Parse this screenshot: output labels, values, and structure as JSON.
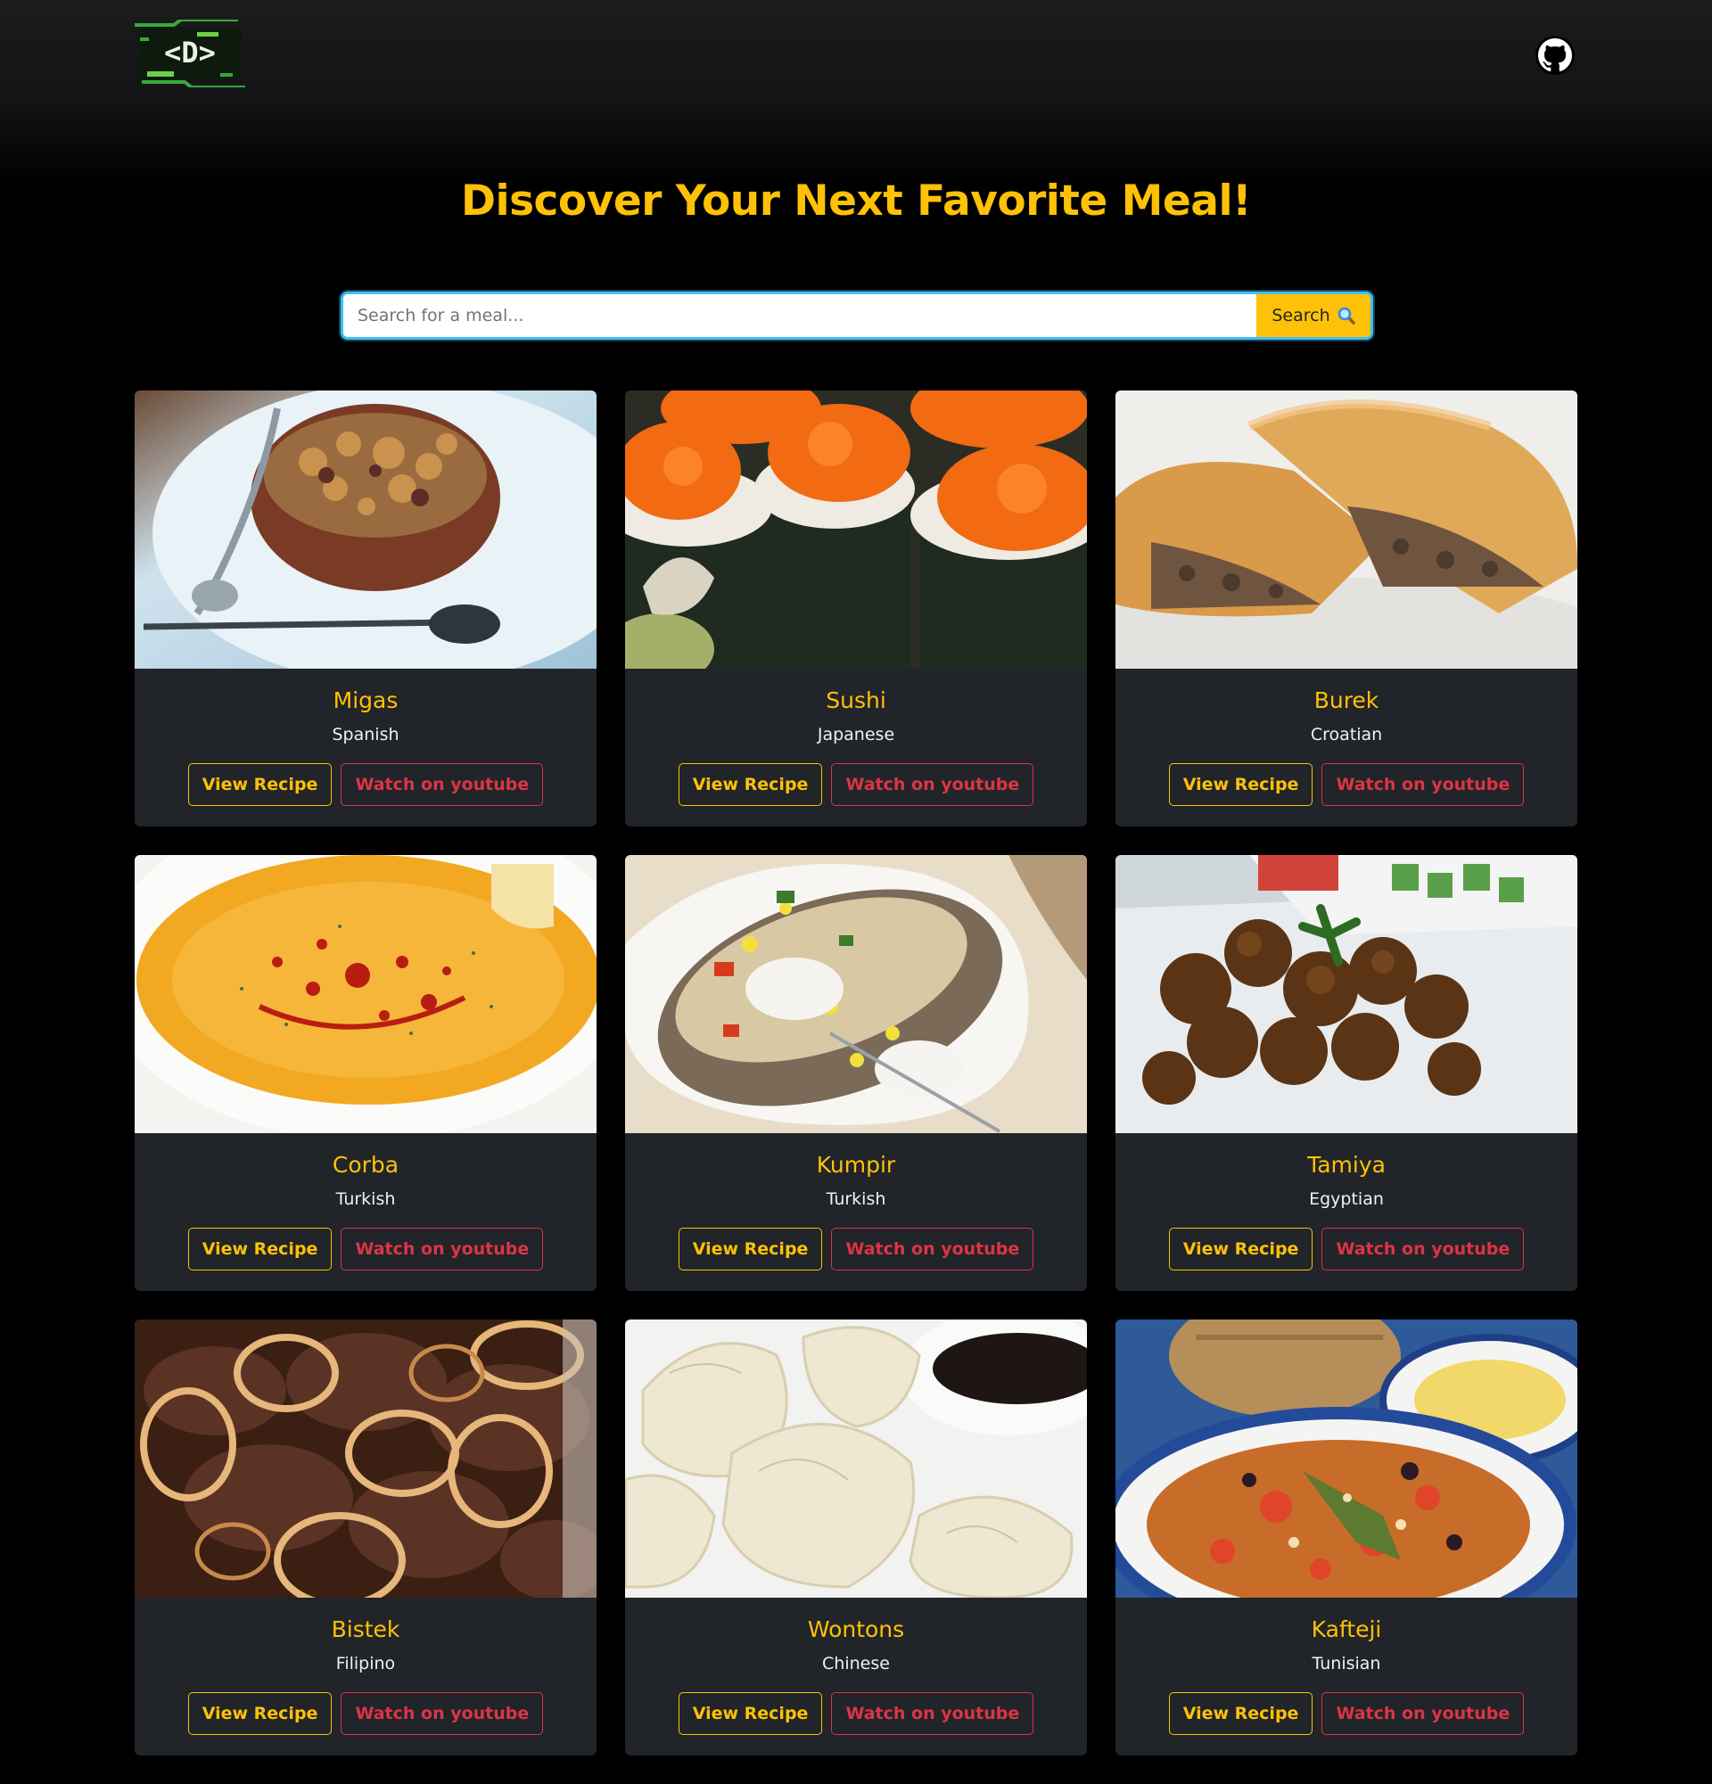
{
  "navbar": {
    "logo_text": "<D>",
    "github_icon": "github-icon"
  },
  "hero": {
    "title": "Discover Your Next Favorite Meal!"
  },
  "search": {
    "placeholder": "Search for a meal...",
    "value": "",
    "button_label": "Search",
    "button_icon": "magnifier-icon"
  },
  "meals": [
    {
      "name": "Migas",
      "area": "Spanish",
      "recipe_label": "View Recipe",
      "youtube_label": "Watch on youtube",
      "image_icon": "migas-image"
    },
    {
      "name": "Sushi",
      "area": "Japanese",
      "recipe_label": "View Recipe",
      "youtube_label": "Watch on youtube",
      "image_icon": "sushi-image"
    },
    {
      "name": "Burek",
      "area": "Croatian",
      "recipe_label": "View Recipe",
      "youtube_label": "Watch on youtube",
      "image_icon": "burek-image"
    },
    {
      "name": "Corba",
      "area": "Turkish",
      "recipe_label": "View Recipe",
      "youtube_label": "Watch on youtube",
      "image_icon": "corba-image"
    },
    {
      "name": "Kumpir",
      "area": "Turkish",
      "recipe_label": "View Recipe",
      "youtube_label": "Watch on youtube",
      "image_icon": "kumpir-image"
    },
    {
      "name": "Tamiya",
      "area": "Egyptian",
      "recipe_label": "View Recipe",
      "youtube_label": "Watch on youtube",
      "image_icon": "tamiya-image"
    },
    {
      "name": "Bistek",
      "area": "Filipino",
      "recipe_label": "View Recipe",
      "youtube_label": "Watch on youtube",
      "image_icon": "bistek-image"
    },
    {
      "name": "Wontons",
      "area": "Chinese",
      "recipe_label": "View Recipe",
      "youtube_label": "Watch on youtube",
      "image_icon": "wontons-image"
    },
    {
      "name": "Kafteji",
      "area": "Tunisian",
      "recipe_label": "View Recipe",
      "youtube_label": "Watch on youtube",
      "image_icon": "kafteji-image"
    }
  ],
  "colors": {
    "accent": "#ffc107",
    "danger": "#dc3545",
    "card_bg": "#212428",
    "search_border": "#3dbff2"
  }
}
